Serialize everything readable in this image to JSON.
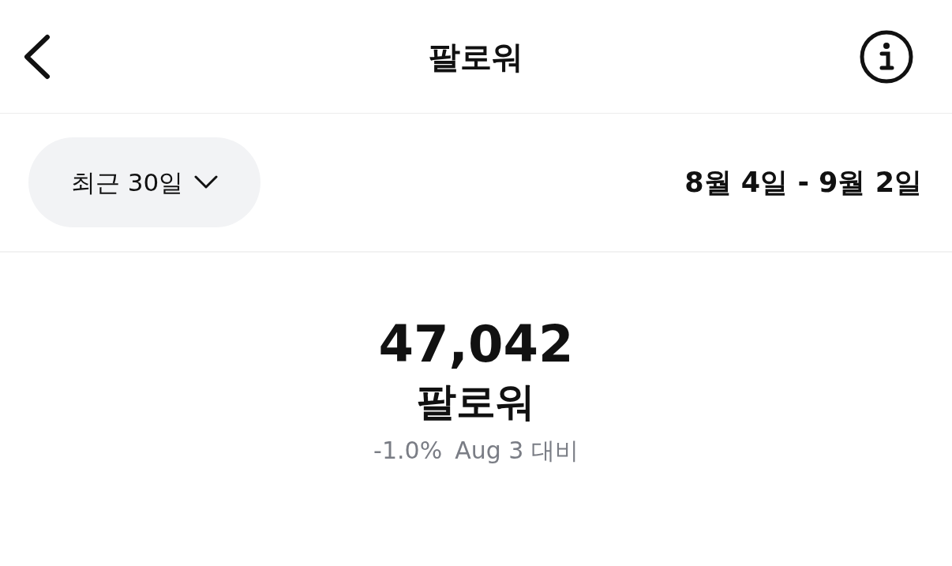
{
  "header": {
    "title": "팔로워"
  },
  "filter": {
    "period": "최근 30일",
    "date_range": "8월 4일 - 9월 2일"
  },
  "stat": {
    "value": "47,042",
    "label": "팔로워",
    "change": "-1.0%",
    "comparison": "Aug 3 대비"
  }
}
